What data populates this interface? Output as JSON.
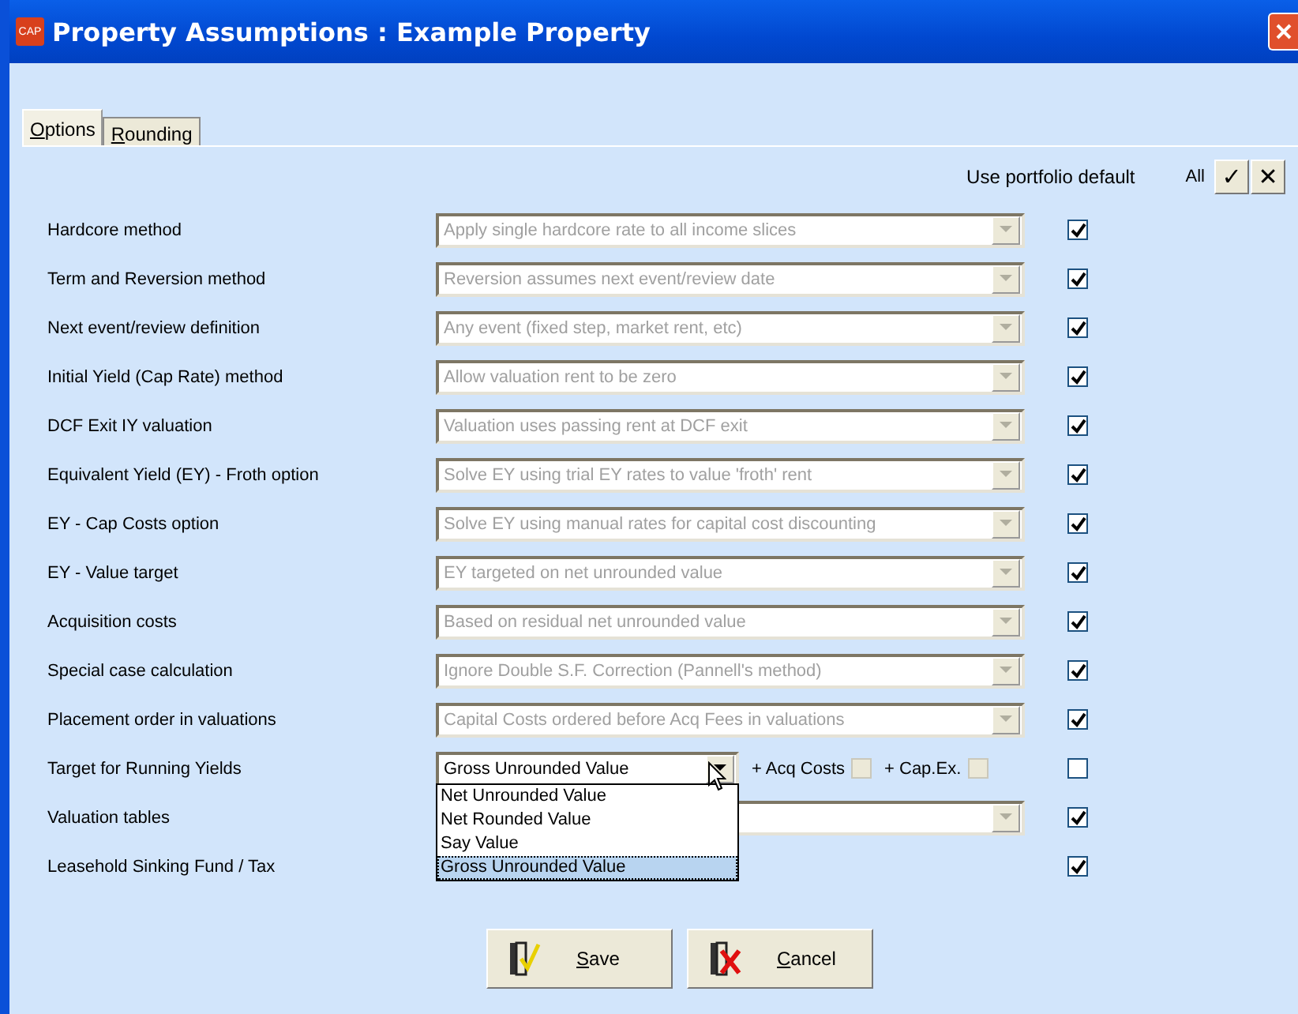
{
  "window": {
    "app_icon_text": "CAP",
    "title": "Property Assumptions : Example Property"
  },
  "tabs": [
    {
      "label": "Options",
      "selected": true
    },
    {
      "label": "Rounding",
      "selected": false
    }
  ],
  "header": {
    "default_label": "Use portfolio default",
    "all_label": "All",
    "check_all": "✓",
    "clear_all": "✕"
  },
  "rows": [
    {
      "kind": "combo",
      "label": "Hardcore method",
      "value": "Apply single hardcore rate to all income slices",
      "disabled": true,
      "checked": true
    },
    {
      "kind": "combo",
      "label": "Term and Reversion method",
      "value": "Reversion assumes next event/review date",
      "disabled": true,
      "checked": true
    },
    {
      "kind": "combo",
      "label": "Next event/review definition",
      "value": "Any event (fixed step, market rent, etc)",
      "disabled": true,
      "checked": true
    },
    {
      "kind": "combo",
      "label": "Initial Yield (Cap Rate) method",
      "value": "Allow valuation rent to be zero",
      "disabled": true,
      "checked": true
    },
    {
      "kind": "combo",
      "label": "DCF Exit IY valuation",
      "value": "Valuation uses passing rent at DCF exit",
      "disabled": true,
      "checked": true
    },
    {
      "kind": "combo",
      "label": "Equivalent Yield (EY) - Froth option",
      "value": "Solve EY using trial EY rates to value 'froth' rent",
      "disabled": true,
      "checked": true
    },
    {
      "kind": "combo",
      "label": "EY - Cap Costs option",
      "value": "Solve EY using manual rates for capital cost discounting",
      "disabled": true,
      "checked": true
    },
    {
      "kind": "combo",
      "label": "EY - Value target",
      "value": "EY targeted on net unrounded value",
      "disabled": true,
      "checked": true
    },
    {
      "kind": "combo",
      "label": "Acquisition costs",
      "value": "Based on residual net unrounded value",
      "disabled": true,
      "checked": true
    },
    {
      "kind": "combo",
      "label": "Special case calculation",
      "value": "Ignore Double S.F. Correction (Pannell's method)",
      "disabled": true,
      "checked": true
    },
    {
      "kind": "combo",
      "label": "Placement order in valuations",
      "value": "Capital Costs ordered before Acq Fees in valuations",
      "disabled": true,
      "checked": true
    },
    {
      "kind": "target",
      "label": "Target for Running Yields",
      "value": "Gross Unrounded Value",
      "disabled": false,
      "checked": false,
      "extras": [
        {
          "label": "+ Acq Costs",
          "checked": false,
          "disabled": true
        },
        {
          "label": "+ Cap.Ex.",
          "checked": false,
          "disabled": true
        }
      ],
      "options": [
        {
          "label": "Net Unrounded Value",
          "selected": false
        },
        {
          "label": "Net Rounded Value",
          "selected": false
        },
        {
          "label": "Say Value",
          "selected": false
        },
        {
          "label": "Gross Unrounded Value",
          "selected": true
        }
      ]
    },
    {
      "kind": "covered",
      "label": "Valuation tables",
      "disabled": true,
      "checked": true
    },
    {
      "kind": "plain",
      "label": "Leasehold Sinking Fund / Tax",
      "checked": true
    }
  ],
  "buttons": [
    {
      "kind": "save",
      "label": "Save"
    },
    {
      "kind": "cancel",
      "label": "Cancel"
    }
  ]
}
